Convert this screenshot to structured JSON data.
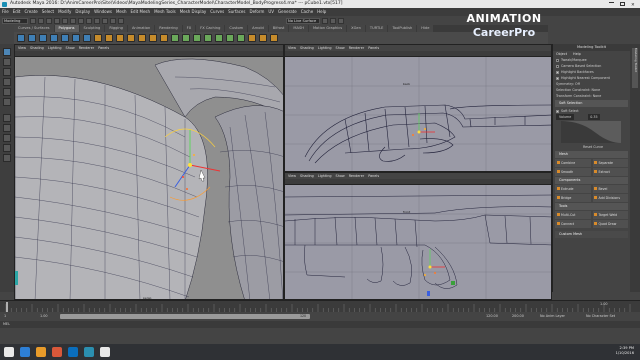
{
  "window": {
    "title": "Autodesk Maya 2016: D:\\AnimCareerPro\\Site\\Videos\\MayaModelingSeries_CharacterModel\\CharacterModel_BodyProgress4.ma*   ---   pCube1.vtx[517]"
  },
  "menubar": [
    "File",
    "Edit",
    "Create",
    "Select",
    "Modify",
    "Display",
    "Windows",
    "Mesh",
    "Edit Mesh",
    "Mesh Tools",
    "Mesh Display",
    "Curves",
    "Surfaces",
    "Deform",
    "UV",
    "Generate",
    "Cache",
    "Help"
  ],
  "status": {
    "mode": "Modeling",
    "live_surface": "No Live Surface"
  },
  "shelf": {
    "tabs": [
      "Curves / Surfaces",
      "Polygons",
      "Sculpting",
      "Rigging",
      "Animation",
      "Rendering",
      "FX",
      "FX Caching",
      "Custom",
      "Arnold",
      "Bifrost",
      "MASH",
      "Motion Graphics",
      "XGen",
      "TURTLE",
      "ToolPublish",
      "Hide"
    ],
    "active_tab": "Polygons"
  },
  "branding": {
    "line1": "ANIMATION",
    "line2": "CareerPro"
  },
  "viewports": {
    "menu": [
      "View",
      "Shading",
      "Lighting",
      "Show",
      "Renderer",
      "Panels"
    ],
    "main": {
      "camera": "persp"
    },
    "top_right": {
      "camera": "back"
    },
    "bottom_right": {
      "camera": "front"
    }
  },
  "modeling_toolkit": {
    "title": "Modeling Toolkit",
    "menu": [
      "Object",
      "Help"
    ],
    "options": [
      {
        "label": "Tweak/Marquee",
        "checked": false
      },
      {
        "label": "Camera Based Selection",
        "checked": false
      },
      {
        "label": "Highlight Backfaces",
        "checked": true
      },
      {
        "label": "Highlight Nearest Component",
        "checked": true
      }
    ],
    "symmetry": "Symmetry:  Off",
    "selection_constraint": "Selection Constraint:  None",
    "transform_constraint": "Transform Constraint:  None",
    "soft_selection": "Soft Selection",
    "soft_select": "Soft Select",
    "volume": "Volume",
    "falloff_value": "0.35",
    "reset_curve": "Reset Curve",
    "sections": {
      "mesh": "Mesh",
      "components": "Components",
      "tools": "Tools"
    },
    "mesh_buttons": [
      "Combine",
      "Separate",
      "Smooth",
      "Extract"
    ],
    "component_buttons": [
      "Extrude",
      "Bevel",
      "Bridge",
      "Add Divisions"
    ],
    "tool_buttons": [
      "Multi-Cut",
      "Target Weld",
      "Connect",
      "Quad Draw"
    ],
    "custom_mesh": "Custom Mesh"
  },
  "timeline": {
    "start": "1",
    "end": "120",
    "range_start": "1.00",
    "range_end": "120",
    "playback_start": "120.00",
    "playback_end": "200.00",
    "current_frame": "1.00",
    "anim_layer": "No Anim Layer",
    "char_set": "No Character Set"
  },
  "command_line": {
    "lang": "MEL"
  },
  "taskbar": {
    "time": "2:39 PM",
    "date": "1/10/2016"
  },
  "colors": {
    "accent": "#4d86b6",
    "viewport_bg": "#8c8c8c",
    "mesh_wire": "#2a2a4a"
  }
}
